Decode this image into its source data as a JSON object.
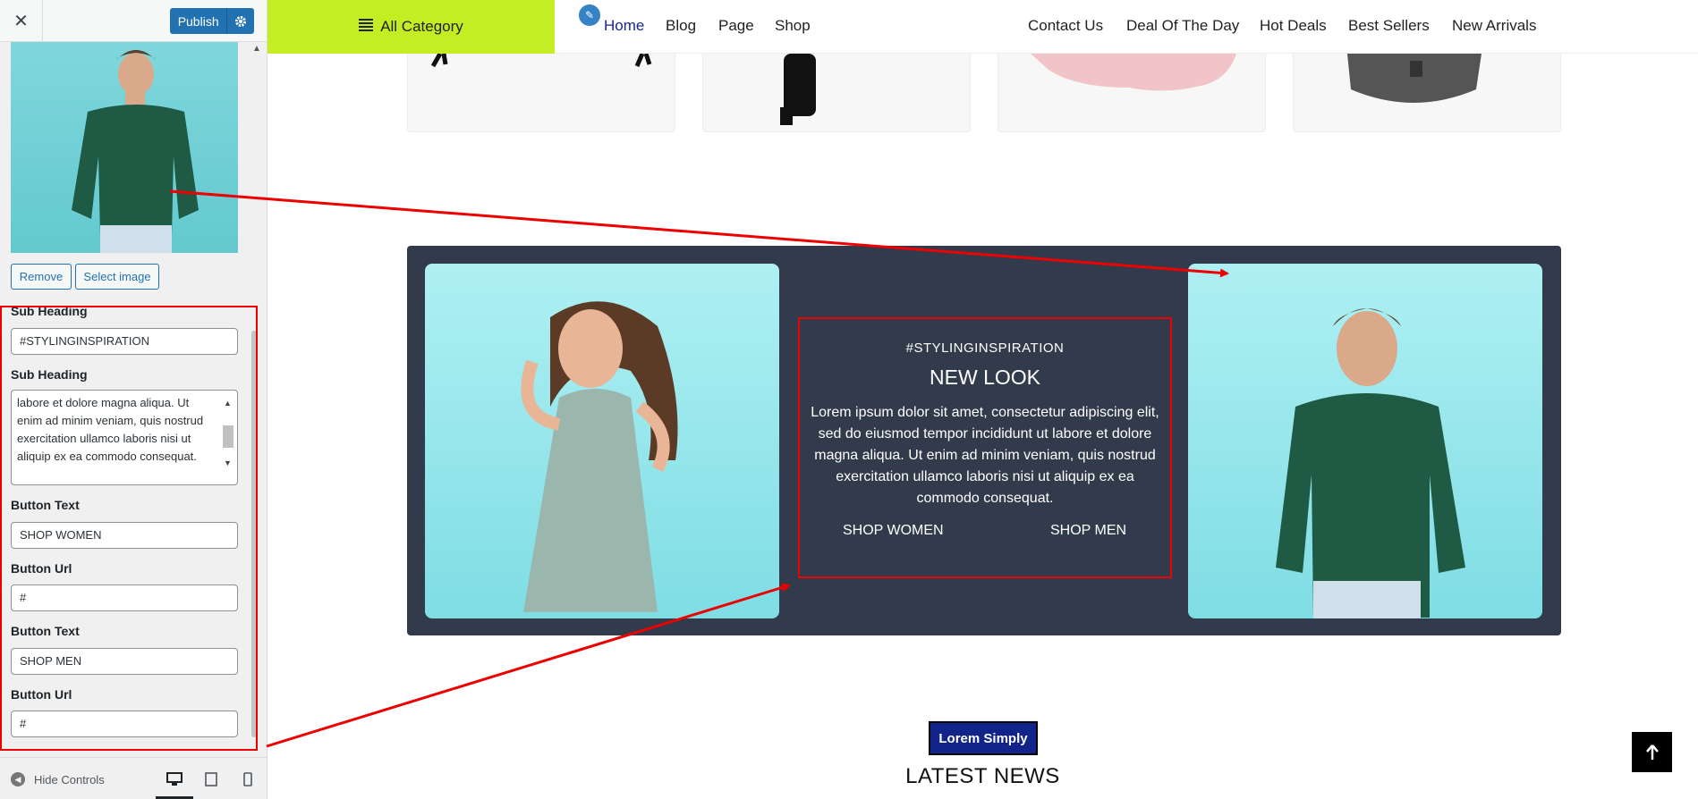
{
  "customizer": {
    "close_icon": "close-icon",
    "publish_label": "Publish",
    "remove_label": "Remove",
    "select_image_label": "Select image",
    "fields": [
      {
        "label": "Sub Heading",
        "value": "#STYLINGINSPIRATION"
      },
      {
        "label": "Sub Heading",
        "value": "labore et dolore magna aliqua. Ut enim ad minim veniam, quis nostrud exercitation ullamco laboris nisi ut aliquip ex ea commodo consequat."
      },
      {
        "label": "Button Text",
        "value": "SHOP WOMEN"
      },
      {
        "label": "Button Url",
        "value": "#"
      },
      {
        "label": "Button Text",
        "value": "SHOP MEN"
      },
      {
        "label": "Button Url",
        "value": "#"
      }
    ],
    "hide_controls_label": "Hide Controls"
  },
  "nav": {
    "all_category": "All Category",
    "left_items": [
      "Home",
      "Blog",
      "Page",
      "Shop"
    ],
    "right_items": [
      "Contact Us",
      "Deal Of The Day",
      "Hot Deals",
      "Best Sellers",
      "New Arrivals"
    ],
    "active_color": "#1a2a8c"
  },
  "banner": {
    "sub_heading": "#STYLINGINSPIRATION",
    "heading": "NEW LOOK",
    "description": "Lorem ipsum dolor sit amet, consectetur adipiscing elit, sed do eiusmod tempor incididunt ut labore et dolore magna aliqua. Ut enim ad minim veniam, quis nostrud exercitation ullamco laboris nisi ut aliquip ex ea commodo consequat.",
    "button_women": "SHOP WOMEN",
    "button_men": "SHOP MEN",
    "background": "#313b4b"
  },
  "news": {
    "badge": "Lorem Simply",
    "heading": "LATEST NEWS"
  },
  "colors": {
    "accent_green": "#c3ee23",
    "wp_blue": "#2271b1",
    "annotation_red": "#e00000"
  }
}
